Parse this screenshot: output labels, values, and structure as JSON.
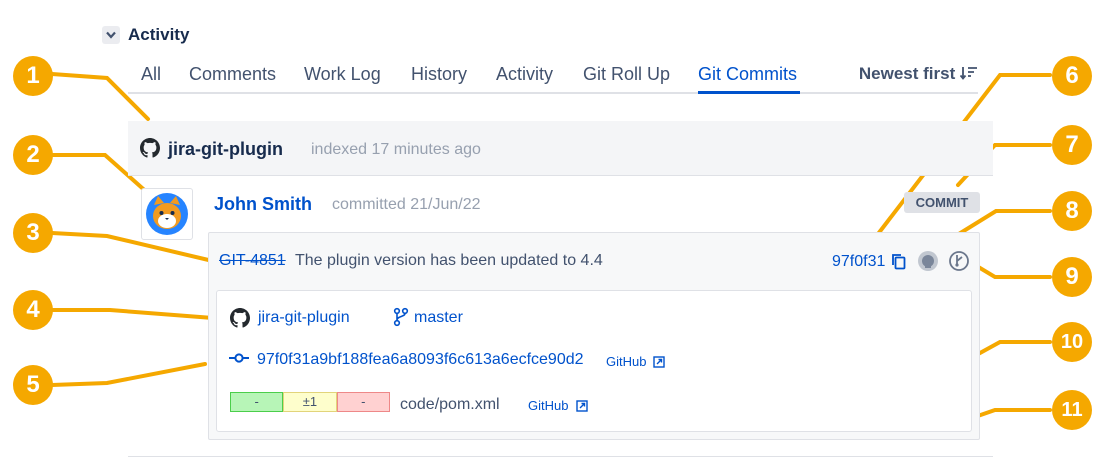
{
  "activity": {
    "title": "Activity"
  },
  "tabs": [
    {
      "label": "All"
    },
    {
      "label": "Comments"
    },
    {
      "label": "Work Log"
    },
    {
      "label": "History"
    },
    {
      "label": "Activity"
    },
    {
      "label": "Git Roll Up"
    },
    {
      "label": "Git Commits",
      "active": true
    }
  ],
  "sort": {
    "label": "Newest first"
  },
  "repo": {
    "name": "jira-git-plugin",
    "indexed": "indexed 17 minutes ago"
  },
  "commit": {
    "author": "John Smith",
    "committed": "committed 21/Jun/22",
    "badge": "COMMIT",
    "issue_key": "GIT-4851",
    "message": "The plugin version has been updated to 4.4",
    "short_hash": "97f0f31",
    "repo": "jira-git-plugin",
    "branch": "master",
    "full_hash": "97f0f31a9bf188fea6a8093f6c613a6ecfce90d2",
    "github_link": "GitHub"
  },
  "file": {
    "added": "-",
    "modified": "±1",
    "deleted": "-",
    "path": "code/pom.xml",
    "github_link": "GitHub"
  },
  "callouts": [
    "1",
    "2",
    "3",
    "4",
    "5",
    "6",
    "7",
    "8",
    "9",
    "10",
    "11"
  ],
  "colors": {
    "callout": "#f5a800",
    "link": "#0052cc",
    "text": "#172b4d"
  }
}
